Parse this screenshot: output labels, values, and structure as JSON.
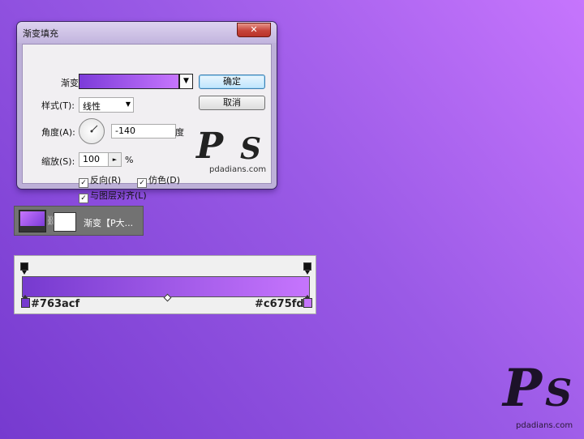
{
  "dialog": {
    "title": "渐变填充",
    "close_glyph": "✕",
    "labels": {
      "gradient": "渐变:",
      "style": "样式(T):",
      "angle": "角度(A):",
      "scale": "缩放(S):",
      "degree_unit": "度",
      "percent_unit": "%"
    },
    "gradient_colors": [
      "#763acf",
      "#c675fd"
    ],
    "style_value": "线性",
    "angle_value": "-140",
    "scale_value": "100",
    "buttons": {
      "ok": "确定",
      "cancel": "取消"
    },
    "checkboxes": [
      {
        "label": "反向(R)",
        "checked": true
      },
      {
        "label": "仿色(D)",
        "checked": true
      },
      {
        "label": "与图层对齐(L)",
        "checked": true
      }
    ],
    "watermark_site": "pdadians.com"
  },
  "layer": {
    "name": "渐变【P大..."
  },
  "gradient_editor": {
    "left_color": "#763acf",
    "right_color": "#c675fd"
  },
  "corner_watermark": {
    "site": "pdadians.com"
  }
}
